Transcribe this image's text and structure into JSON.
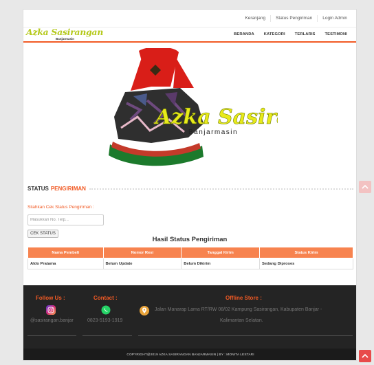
{
  "topbar": {
    "links": [
      "Keranjang",
      "Status Pengiriman",
      "Login Admin"
    ]
  },
  "brand": {
    "name": "Azka Sasirangan",
    "sub": "Banjarmasin"
  },
  "nav": {
    "items": [
      "BERANDA",
      "KATEGORI",
      "TERLARIS",
      "TESTIMONI"
    ]
  },
  "hero": {
    "logo_text": "Azka Sasirangan",
    "logo_sub": "Banjarmasin"
  },
  "status_section": {
    "title_plain": "STATUS",
    "title_accent": "PENGIRIMAN"
  },
  "form": {
    "label": "Silahkan Cek Status Pengiriman :",
    "placeholder": "Masukkan No. Telp...",
    "button": "CEK STATUS"
  },
  "results": {
    "title": "Hasil Status Pengiriman",
    "columns": [
      "Nama Pembeli",
      "Nomor Resi",
      "Tanggal Kirim",
      "Status Kirim"
    ],
    "rows": [
      [
        "Aldo Pratama",
        "Belum Update",
        "Belum Dikirim",
        "Sedang Diproses"
      ]
    ]
  },
  "footer": {
    "follow_heading": "Follow Us :",
    "instagram": "@sasirangan.banjar",
    "contact_heading": "Contact :",
    "phone": "0823-5193-1919",
    "offline_heading": "Offline Store :",
    "address_line1": "Jalan Manarap Lama RT/RW 08/02 Kampung Sasirangan, Kabupaten Banjar -",
    "address_line2": "Kalimantan Selatan."
  },
  "copyright": "COPYRIGHT@2019 AZKA SASIRANGAN BANJARMASIN | BY : MONITA LESTARI",
  "colors": {
    "accent": "#f15a24",
    "table_header": "#f7834f",
    "footer_bg": "#242424",
    "brand_green": "#b5c91b",
    "whatsapp": "#25d366",
    "scroll_btn": "#e84a4a"
  },
  "icons": [
    "instagram-icon",
    "whatsapp-icon",
    "map-pin-icon",
    "chevron-up-icon"
  ]
}
